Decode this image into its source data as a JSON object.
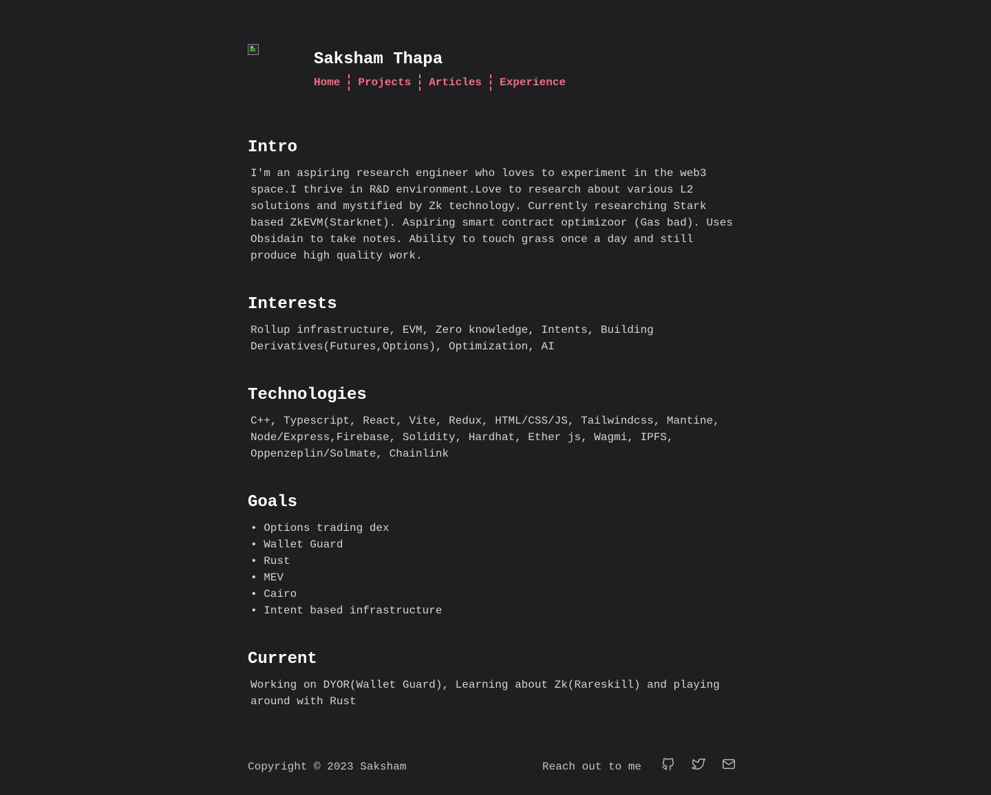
{
  "header": {
    "avatar_alt": "",
    "title": "Saksham Thapa",
    "nav": [
      "Home",
      "Projects",
      "Articles",
      "Experience"
    ]
  },
  "sections": {
    "intro": {
      "heading": "Intro",
      "text": "I'm an aspiring research engineer who loves to experiment in the web3 space.I thrive in R&D environment.Love to research about various L2 solutions and mystified by Zk technology. Currently researching Stark based ZkEVM(Starknet). Aspiring smart contract optimizoor (Gas bad). Uses Obsidain to take notes. Ability to touch grass once a day and still produce high quality work."
    },
    "interests": {
      "heading": "Interests",
      "text": "Rollup infrastructure, EVM, Zero knowledge, Intents, Building Derivatives(Futures,Options), Optimization, AI"
    },
    "technologies": {
      "heading": "Technologies",
      "text": "C++, Typescript, React, Vite, Redux, HTML/CSS/JS, Tailwindcss, Mantine, Node/Express,Firebase, Solidity, Hardhat, Ether js, Wagmi, IPFS, Oppenzeplin/Solmate, Chainlink"
    },
    "goals": {
      "heading": "Goals",
      "items": [
        "• Options trading dex",
        "• Wallet Guard",
        "• Rust",
        "• MEV",
        "• Cairo",
        "• Intent based infrastructure"
      ]
    },
    "current": {
      "heading": "Current",
      "text": "Working on DYOR(Wallet Guard), Learning about Zk(Rareskill) and playing around with Rust"
    }
  },
  "footer": {
    "copyright": "Copyright © 2023 Saksham",
    "reach_label": "Reach out to me",
    "icons": [
      "github-icon",
      "twitter-icon",
      "mail-icon"
    ]
  },
  "colors": {
    "background": "#1f1f21",
    "accent": "#ee6d85",
    "heading": "#ffffff",
    "text": "#d4d4d4"
  }
}
